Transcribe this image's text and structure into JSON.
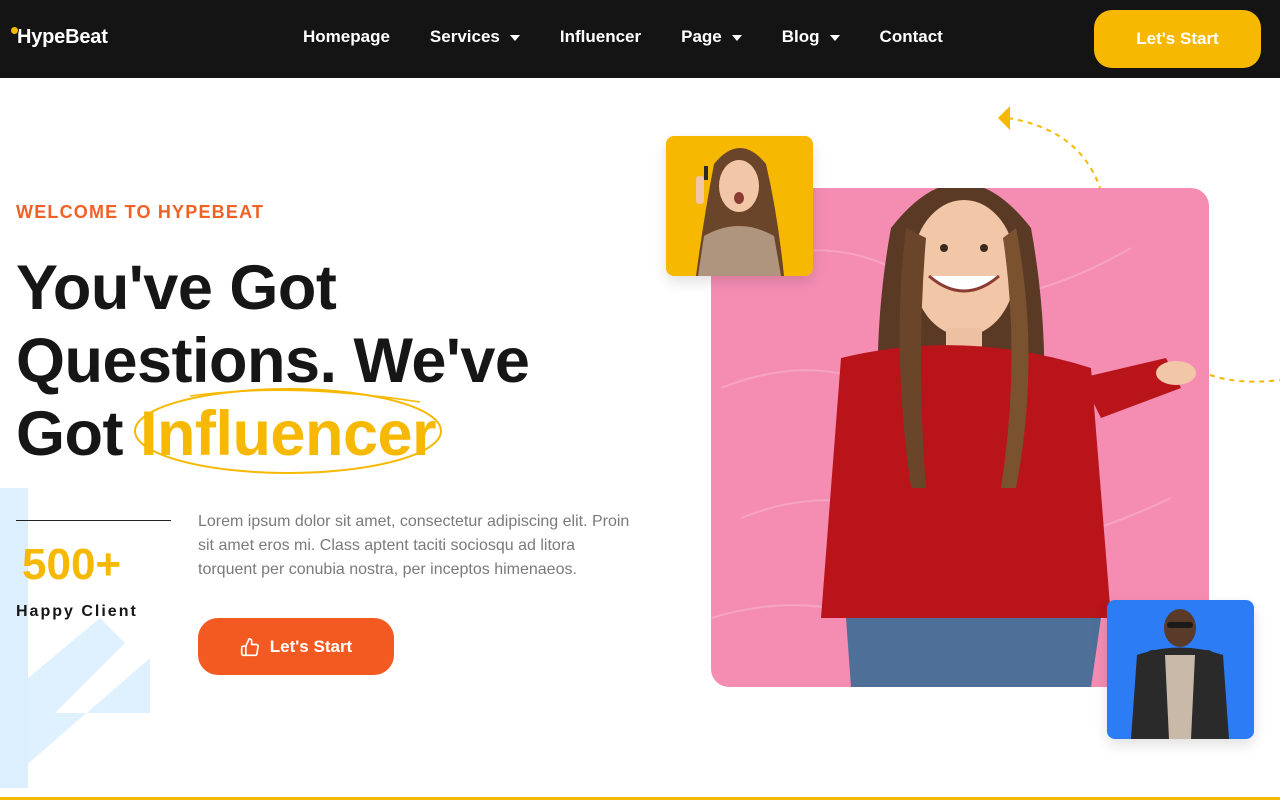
{
  "brand": {
    "name": "HypeBeat",
    "accent": "#f6b800",
    "orange": "#f25a22"
  },
  "nav": {
    "items": [
      {
        "label": "Homepage",
        "dropdown": false
      },
      {
        "label": "Services",
        "dropdown": true
      },
      {
        "label": "Influencer",
        "dropdown": false
      },
      {
        "label": "Page",
        "dropdown": true
      },
      {
        "label": "Blog",
        "dropdown": true
      },
      {
        "label": "Contact",
        "dropdown": false
      }
    ],
    "cta_label": "Let's Start"
  },
  "hero": {
    "eyebrow": "WELCOME TO HYPEBEAT",
    "title_line1": "You've Got",
    "title_line2": "Questions. We've",
    "title_line3_prefix": "Got",
    "title_highlight": "Influencer",
    "stat_number": "500+",
    "stat_label": "Happy Client",
    "description": "Lorem ipsum dolor sit amet, consectetur adipiscing elit. Proin sit amet eros mi. Class aptent taciti sociosqu ad litora torquent per conubia nostra, per inceptos himenaeos.",
    "cta_label": "Let's Start",
    "cta_icon": "thumbs-up-icon"
  },
  "images": {
    "main": "woman-portrait-photo",
    "thumb_top": "woman-lipstick-photo",
    "thumb_bottom": "man-jacket-photo"
  }
}
